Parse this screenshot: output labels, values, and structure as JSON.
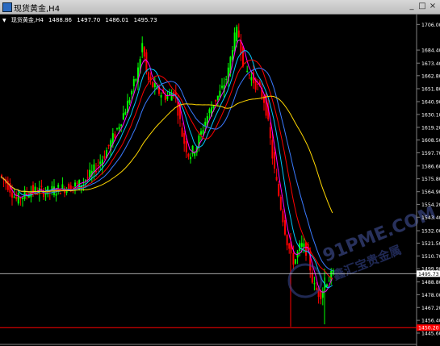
{
  "window": {
    "title": "现货黄金,H4",
    "icon": "chart-window-icon",
    "controls": [
      "_",
      "□",
      "×"
    ]
  },
  "header": {
    "symbol": "现货黄金,H4",
    "open": "1488.86",
    "high": "1497.70",
    "low": "1486.01",
    "close": "1495.73"
  },
  "chart_data": {
    "type": "candlestick",
    "symbol": "现货黄金",
    "timeframe": "H4",
    "y_ticks": [
      "1706.00",
      "1684.40",
      "1673.40",
      "1662.80",
      "1651.80",
      "1640.90",
      "1630.10",
      "1619.20",
      "1608.50",
      "1597.70",
      "1586.60",
      "1575.80",
      "1564.90",
      "1554.20",
      "1543.40",
      "1532.00",
      "1521.50",
      "1510.70",
      "1499.90",
      "1488.80",
      "1478.00",
      "1467.20",
      "1456.40",
      "1445.60"
    ],
    "ylim": [
      1445.6,
      1711.0
    ],
    "current_price": "1495.73",
    "line_price": 1495.73,
    "low_label": "1450.20",
    "low_line_price": 1450.2,
    "colors": {
      "bull": "#00ff00",
      "bear": "#ff0000",
      "ma_fast": "#ff00ff",
      "ma_mid": "#00c8ff",
      "ma_slow": "#ffd700",
      "ma_slow_long": "#c8c800",
      "price_line": "#c0c0c0",
      "low_line": "#ff0000"
    }
  },
  "watermark": {
    "text": "91PME.COM",
    "subtitle": "鑫汇宝贵金属"
  }
}
